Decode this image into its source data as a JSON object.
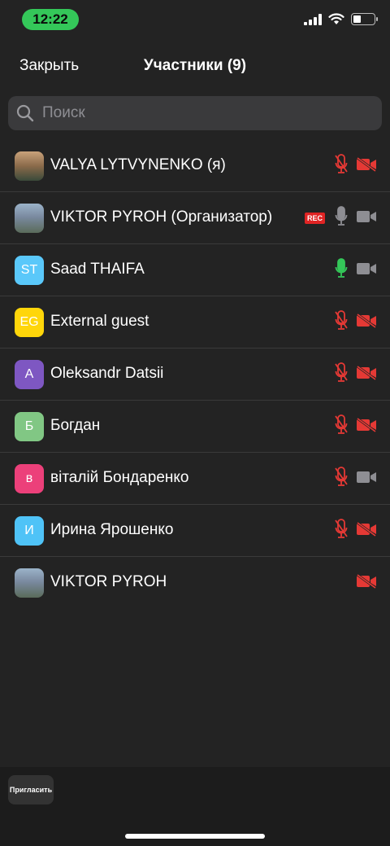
{
  "status_bar": {
    "time": "12:22",
    "icons": [
      "signal-icon",
      "wifi-icon",
      "battery-icon"
    ]
  },
  "header": {
    "close_label": "Закрыть",
    "title": "Участники (9)"
  },
  "search": {
    "placeholder": "Поиск",
    "value": ""
  },
  "participants": [
    {
      "name": "VALYA LYTVYNENKO (я)",
      "avatar_type": "photo",
      "initials": "",
      "avatar_color": "",
      "rec": false,
      "mic": "muted",
      "video": "off"
    },
    {
      "name": "VIKTOR PYROH (Организатор)",
      "avatar_type": "photo",
      "initials": "",
      "avatar_color": "",
      "rec": true,
      "rec_label": "REC",
      "mic": "on-idle",
      "video": "on"
    },
    {
      "name": "Saad THAIFA",
      "avatar_type": "initials",
      "initials": "ST",
      "avatar_color": "#5ac8fa",
      "rec": false,
      "mic": "speaking",
      "video": "on"
    },
    {
      "name": "External guest",
      "avatar_type": "initials",
      "initials": "EG",
      "avatar_color": "#ffd60a",
      "rec": false,
      "mic": "muted",
      "video": "off"
    },
    {
      "name": "Oleksandr Datsii",
      "avatar_type": "initials",
      "initials": "A",
      "avatar_color": "#7e57c2",
      "rec": false,
      "mic": "muted",
      "video": "off"
    },
    {
      "name": "Богдан",
      "avatar_type": "initials",
      "initials": "Б",
      "avatar_color": "#81c784",
      "rec": false,
      "mic": "muted",
      "video": "off"
    },
    {
      "name": "віталій Бондаренко",
      "avatar_type": "initials",
      "initials": "в",
      "avatar_color": "#ec407a",
      "rec": false,
      "mic": "muted",
      "video": "on"
    },
    {
      "name": "Ирина Ярошенко",
      "avatar_type": "initials",
      "initials": "И",
      "avatar_color": "#4fc3f7",
      "rec": false,
      "mic": "muted",
      "video": "off"
    },
    {
      "name": "VIKTOR PYROH",
      "avatar_type": "photo",
      "initials": "",
      "avatar_color": "",
      "rec": false,
      "mic": "none",
      "video": "off"
    }
  ],
  "bottom_bar": {
    "invite_label": "Пригласить"
  },
  "colors": {
    "background": "#232323",
    "muted_red": "#e53935",
    "speaking_green": "#34c759",
    "idle_grey": "#8e8e93",
    "time_pill": "#34c759"
  }
}
